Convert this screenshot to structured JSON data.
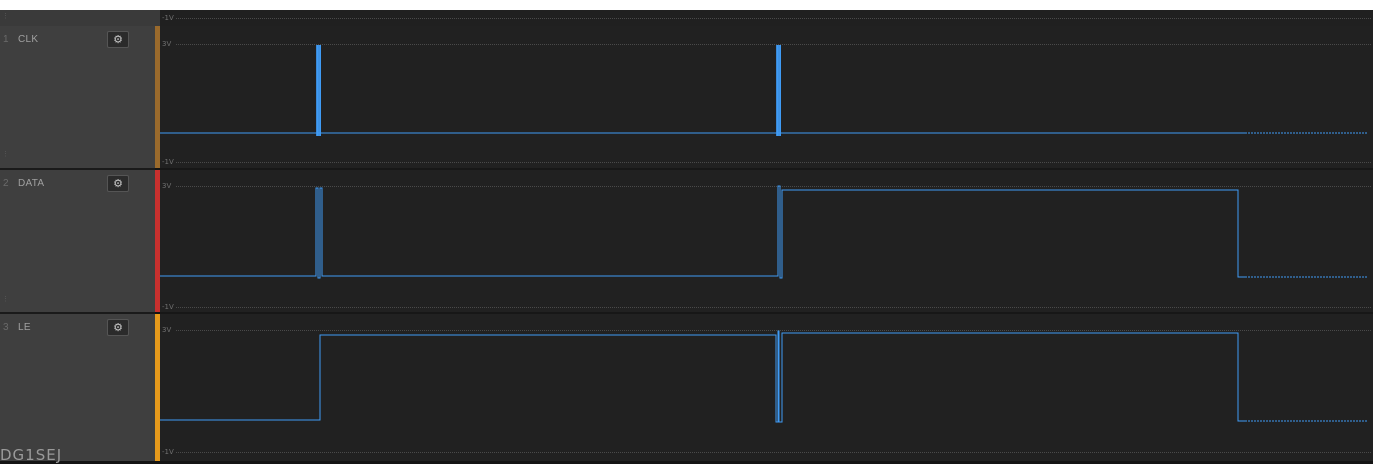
{
  "voltage_scale": {
    "high": "3V",
    "low": "-1V"
  },
  "colors": {
    "trace": "#3f9bf5",
    "clk_bar": "#9a6a2c",
    "data_bar": "#c8302e",
    "le_bar": "#e69a1c"
  },
  "channels": [
    {
      "number": "1",
      "name": "CLK",
      "settings_icon": "gear-icon"
    },
    {
      "number": "2",
      "name": "DATA",
      "settings_icon": "gear-icon"
    },
    {
      "number": "3",
      "name": "LE",
      "settings_icon": "gear-icon"
    }
  ],
  "watermark": "DG1SEJ"
}
